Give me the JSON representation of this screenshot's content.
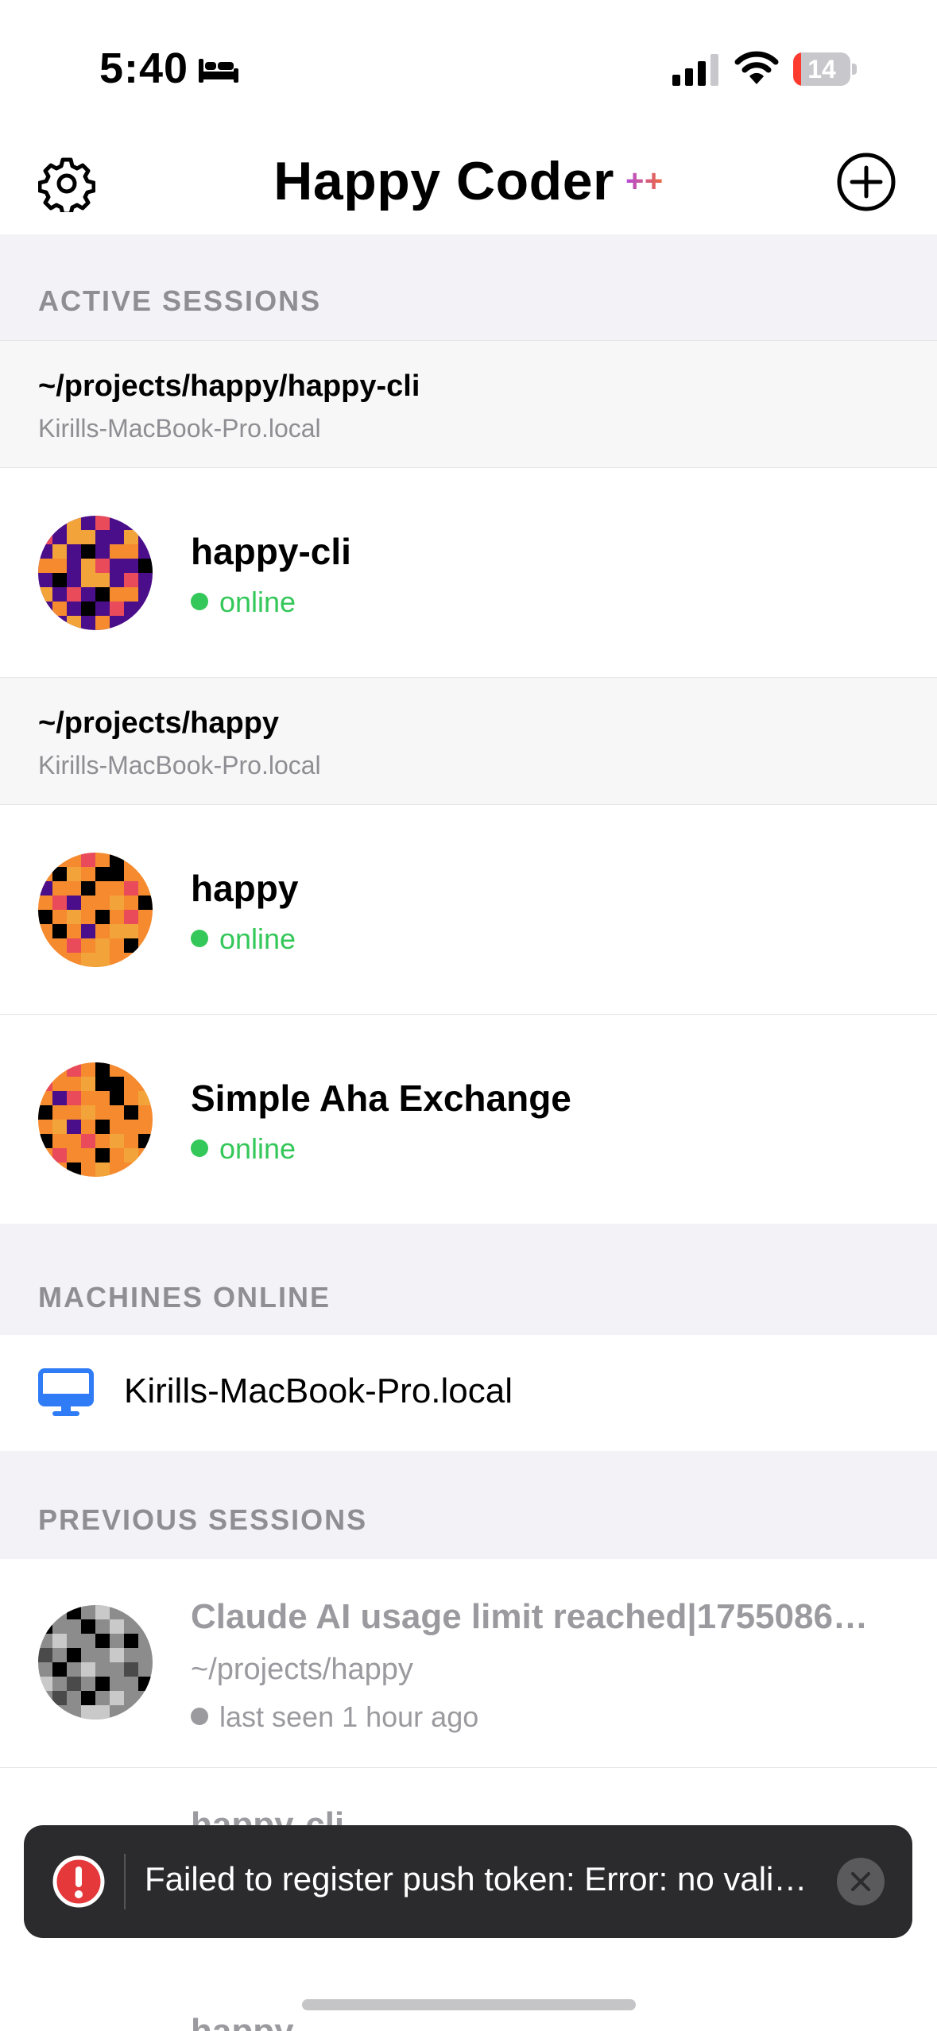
{
  "status_bar": {
    "time": "5:40",
    "battery": "14",
    "battery_level": 0.14
  },
  "header": {
    "title": "Happy Coder",
    "title_suffix": "++",
    "accent_from": "#b24bd9",
    "accent_to": "#f06a3c"
  },
  "sections": {
    "active": "ACTIVE SESSIONS",
    "machines": "MACHINES ONLINE",
    "previous": "PREVIOUS SESSIONS"
  },
  "active_groups": [
    {
      "path": "~/projects/happy/happy-cli",
      "host": "Kirills-MacBook-Pro.local",
      "sessions": [
        {
          "name": "happy-cli",
          "status": "online"
        }
      ]
    },
    {
      "path": "~/projects/happy",
      "host": "Kirills-MacBook-Pro.local",
      "sessions": [
        {
          "name": "happy",
          "status": "online"
        },
        {
          "name": "Simple Aha Exchange",
          "status": "online"
        }
      ]
    }
  ],
  "machines": [
    {
      "name": "Kirills-MacBook-Pro.local",
      "icon": "desktop-icon"
    }
  ],
  "previous_sessions": [
    {
      "title": "Claude AI usage limit reached|1755086…",
      "path": "~/projects/happy",
      "last_seen": "last seen 1 hour ago"
    },
    {
      "title": "happy-cli"
    },
    {
      "title": "happy"
    }
  ],
  "toast": {
    "message": "Failed to register push token: Error: no vali…",
    "icon": "error-icon"
  },
  "colors": {
    "online": "#34c759",
    "toast_bg": "#2b2b2d",
    "error": "#e5383b",
    "link_blue": "#2f7cf6"
  }
}
